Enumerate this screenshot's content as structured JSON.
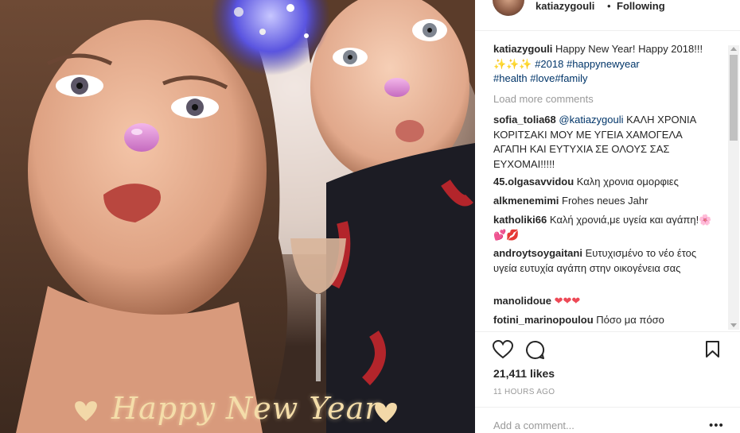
{
  "header": {
    "username": "katiazygouli",
    "separator": "•",
    "follow_status": "Following"
  },
  "photo": {
    "overlay_text": "Happy New Year",
    "description_icons": [
      "heart-left-icon",
      "heart-right-icon"
    ]
  },
  "caption": {
    "username": "katiazygouli",
    "text": "Happy New Year! Happy 2018!!!✨✨✨",
    "hashtags": [
      "#2018",
      "#happynewyear",
      "#health",
      "#love",
      "#family"
    ]
  },
  "load_more": "Load more comments",
  "comments": [
    {
      "user": "sofia_tolia68",
      "mention": "@katiazygouli",
      "text": "ΚΑΛΗ ΧΡΟΝΙΑ ΚΟΡΙΤΣΑΚΙ ΜΟΥ ΜΕ ΥΓΕΙΑ ΧΑΜΟΓΕΛΑ ΑΓΑΠΗ ΚΑΙ ΕΥΤΥΧΙΑ ΣΕ ΟΛΟΥΣ ΣΑΣ ΕΥΧΟΜΑΙ!!!!!"
    },
    {
      "user": "45.olgasavvidou",
      "text": "Καλη χρονια ομορφιες"
    },
    {
      "user": "alkmenemimi",
      "text": "Frohes neues Jahr"
    },
    {
      "user": "katholiki66",
      "text": "Καλή χρονιά,με υγεία και αγάπη!🌸💕💋"
    },
    {
      "user": "androytsoygaitani",
      "text": "Ευτυχισμένο το νέο έτος υγεία ευτυχία αγάπη στην οικογένεια σας"
    },
    {
      "user": "manolidoue",
      "text": "❤❤❤"
    },
    {
      "user": "fotini_marinopoulou",
      "text": "Πόσο μα πόσο"
    }
  ],
  "actions": {
    "like_icon": "heart-outline-icon",
    "comment_icon": "comment-bubble-icon",
    "save_icon": "bookmark-icon"
  },
  "likes": "21,411 likes",
  "time_ago": "11 HOURS AGO",
  "add_comment": {
    "placeholder": "Add a comment...",
    "more": "•••"
  },
  "colors": {
    "hashtag": "#003569",
    "muted": "#999999",
    "text": "#262626",
    "heart": "#ed4956"
  }
}
